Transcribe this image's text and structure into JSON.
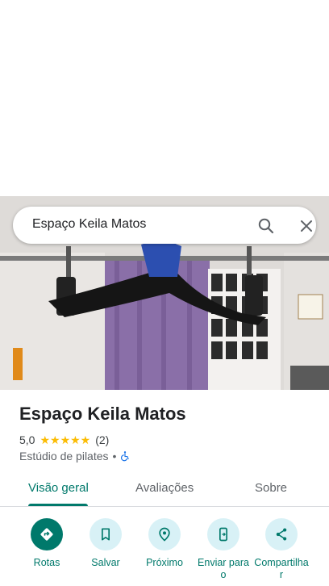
{
  "search": {
    "value": "Espaço Keila Matos"
  },
  "place": {
    "title": "Espaço Keila Matos",
    "rating": "5,0",
    "stars": "★★★★★",
    "review_count": "(2)",
    "category": "Estúdio de pilates",
    "separator": "•",
    "accessibility_icon": "wheelchair-icon"
  },
  "tabs": [
    {
      "label": "Visão geral",
      "active": true
    },
    {
      "label": "Avaliações",
      "active": false
    },
    {
      "label": "Sobre",
      "active": false
    }
  ],
  "actions": [
    {
      "label": "Rotas",
      "icon": "directions-icon"
    },
    {
      "label": "Salvar",
      "icon": "bookmark-icon"
    },
    {
      "label": "Próximo",
      "icon": "nearby-icon"
    },
    {
      "label": "Enviar para o",
      "icon": "send-to-phone-icon"
    },
    {
      "label": "Compartilhar",
      "icon": "share-icon"
    }
  ],
  "colors": {
    "accent": "#00796b",
    "action_bg": "#d8f1f6",
    "star": "#fbbc04"
  }
}
